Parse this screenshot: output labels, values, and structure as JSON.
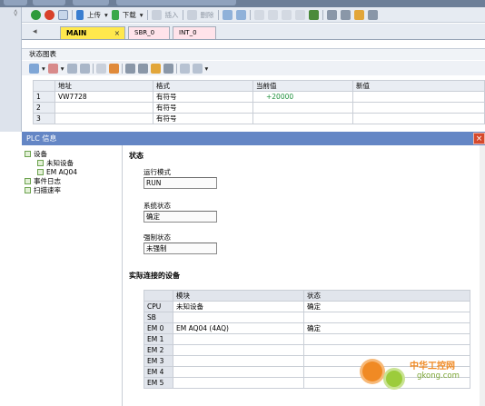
{
  "toolbar": {
    "upload": "上传",
    "download": "下载",
    "insert": "插入",
    "delete": "删除"
  },
  "tabs": [
    {
      "label": "MAIN",
      "close": "×"
    },
    {
      "label": "SBR_0"
    },
    {
      "label": "INT_0"
    }
  ],
  "status_chart": {
    "title": "状态图表",
    "columns": [
      "地址",
      "格式",
      "当前值",
      "新值"
    ],
    "rows": [
      {
        "num": "1",
        "address": "VW7728",
        "format": "有符号",
        "current": "+20000",
        "new": ""
      },
      {
        "num": "2",
        "address": "",
        "format": "有符号",
        "current": "",
        "new": ""
      },
      {
        "num": "3",
        "address": "",
        "format": "有符号",
        "current": "",
        "new": ""
      }
    ]
  },
  "plc_window": {
    "title": "PLC 信息",
    "close": "×",
    "tree": [
      {
        "label": "设备"
      },
      {
        "label": "未知设备"
      },
      {
        "label": "EM AQ04"
      },
      {
        "label": "事件日志"
      },
      {
        "label": "扫描速率"
      }
    ],
    "status_heading": "状态",
    "run_mode_label": "运行模式",
    "run_mode_value": "RUN",
    "system_state_label": "系统状态",
    "system_state_value": "确定",
    "force_state_label": "强制状态",
    "force_state_value": "未强制",
    "devices_heading": "实际连接的设备",
    "device_columns": [
      "模块",
      "状态"
    ],
    "devices": [
      {
        "slot": "CPU",
        "module": "未知设备",
        "status": "确定"
      },
      {
        "slot": "SB",
        "module": "",
        "status": ""
      },
      {
        "slot": "EM 0",
        "module": "EM AQ04 (4AQ)",
        "status": "确定"
      },
      {
        "slot": "EM 1",
        "module": "",
        "status": ""
      },
      {
        "slot": "EM 2",
        "module": "",
        "status": ""
      },
      {
        "slot": "EM 3",
        "module": "",
        "status": ""
      },
      {
        "slot": "EM 4",
        "module": "",
        "status": ""
      },
      {
        "slot": "EM 5",
        "module": "",
        "status": ""
      }
    ]
  },
  "watermark": {
    "cn": "中华工控网",
    "en": "gkong.com"
  }
}
